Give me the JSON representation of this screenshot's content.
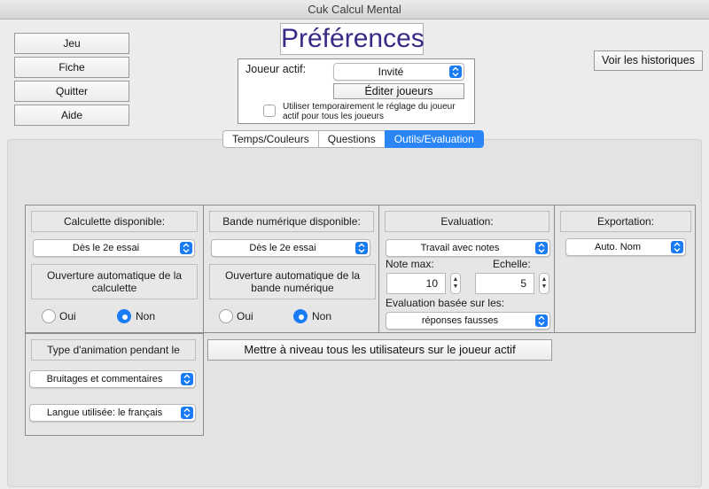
{
  "window": {
    "title": "Cuk Calcul Mental"
  },
  "left_buttons": [
    "Jeu",
    "Fiche",
    "Quitter",
    "Aide"
  ],
  "page_title": "Préférences",
  "player": {
    "label": "Joueur actif:",
    "selected": "Invité",
    "edit_label": "Éditer joueurs",
    "temp_checkbox_label": "Utiliser temporairement le réglage du joueur actif pour tous les joueurs",
    "temp_checked": false
  },
  "history_button": "Voir les historiques",
  "tabs": [
    {
      "label": "Temps/Couleurs",
      "active": false
    },
    {
      "label": "Questions",
      "active": false
    },
    {
      "label": "Outils/Evaluation",
      "active": true
    }
  ],
  "calculette": {
    "title": "Calculette disponible:",
    "selected": "Dès le 2e essai",
    "auto_label": "Ouverture automatique de la calculette",
    "oui": "Oui",
    "non": "Non",
    "selected_option": "Non"
  },
  "bande": {
    "title": "Bande numérique disponible:",
    "selected": "Dès le 2e essai",
    "auto_label": "Ouverture automatique de la bande numérique",
    "oui": "Oui",
    "non": "Non",
    "selected_option": "Non"
  },
  "evaluation": {
    "title": "Evaluation:",
    "selected": "Travail avec notes",
    "note_max_label": "Note max:",
    "note_max": "10",
    "echelle_label": "Echelle:",
    "echelle": "5",
    "based_label": "Evaluation basée sur les:",
    "based_selected": "réponses fausses"
  },
  "exportation": {
    "title": "Exportation:",
    "selected": "Auto. Nom"
  },
  "animation": {
    "title": "Type d'animation pendant le",
    "selected": "Bruitages et commentaires",
    "language_selected": "Langue utilisée: le français"
  },
  "upgrade_button": "Mettre à niveau tous les utilisateurs sur le joueur actif",
  "colors": {
    "accent": "#1a7cf5",
    "title": "#3a2a86"
  }
}
